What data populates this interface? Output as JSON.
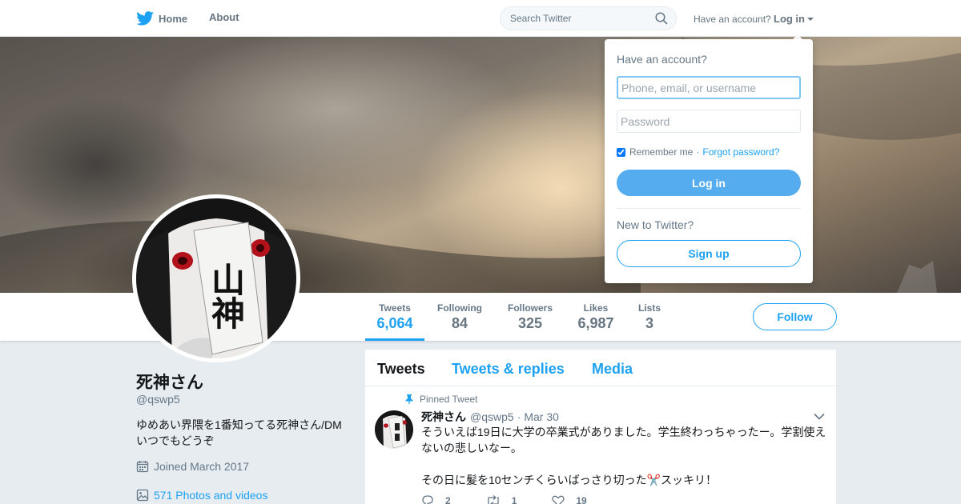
{
  "nav": {
    "home_label": "Home",
    "about_label": "About",
    "search_placeholder": "Search Twitter",
    "account_question": "Have an account?",
    "login_label": "Log in"
  },
  "stats": [
    {
      "label": "Tweets",
      "value": "6,064"
    },
    {
      "label": "Following",
      "value": "84"
    },
    {
      "label": "Followers",
      "value": "325"
    },
    {
      "label": "Likes",
      "value": "6,987"
    },
    {
      "label": "Lists",
      "value": "3"
    }
  ],
  "follow_label": "Follow",
  "profile": {
    "name": "死神さん",
    "handle": "@qswp5",
    "bio": "ゆめあい界隈を1番知ってる死神さん/DMいつでもどうぞ",
    "joined": "Joined March 2017",
    "photos": "571 Photos and videos",
    "avatar_text": "山神"
  },
  "timeline": {
    "tabs": [
      "Tweets",
      "Tweets & replies",
      "Media"
    ]
  },
  "tweet": {
    "pinned_label": "Pinned Tweet",
    "name": "死神さん",
    "handle": "@qswp5",
    "separator": "·",
    "date": "Mar 30",
    "text_line1": "そういえば19日に大学の卒業式がありました。学生終わっちゃったー。学割使えないの悲しいなー。",
    "text_line2": "その日に髪を10センチくらいばっさり切った✂️スッキリ！",
    "replies": "2",
    "retweets": "1",
    "likes": "19"
  },
  "login_dropdown": {
    "title": "Have an account?",
    "username_placeholder": "Phone, email, or username",
    "password_placeholder": "Password",
    "remember_label": "Remember me",
    "separator": "·",
    "forgot_label": "Forgot password?",
    "login_button": "Log in",
    "new_question": "New to Twitter?",
    "signup_button": "Sign up"
  },
  "colors": {
    "accent": "#1da1f2",
    "login_button_bg": "#55acee",
    "page_bg": "#e6ecf0"
  }
}
